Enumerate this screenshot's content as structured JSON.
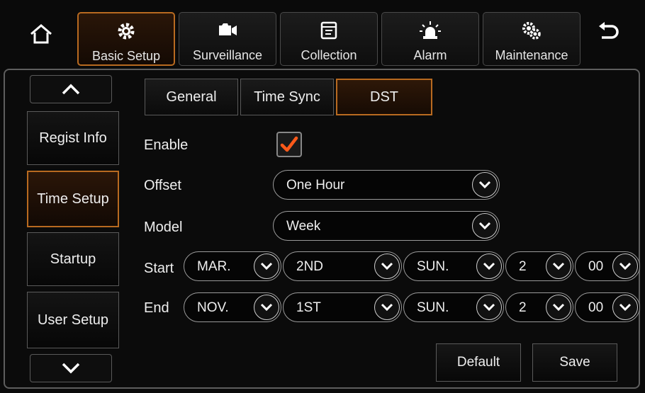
{
  "top_tabs": [
    {
      "label": "Basic Setup",
      "icon": "gear-icon",
      "active": true
    },
    {
      "label": "Surveillance",
      "icon": "camera-icon",
      "active": false
    },
    {
      "label": "Collection",
      "icon": "document-icon",
      "active": false
    },
    {
      "label": "Alarm",
      "icon": "siren-icon",
      "active": false
    },
    {
      "label": "Maintenance",
      "icon": "maintenance-gears-icon",
      "active": false
    }
  ],
  "sidebar": {
    "items": [
      {
        "label": "Regist Info"
      },
      {
        "label": "Time Setup"
      },
      {
        "label": "Startup"
      },
      {
        "label": "User Setup"
      }
    ],
    "active_index": 1
  },
  "sub_tabs": [
    {
      "label": "General"
    },
    {
      "label": "Time Sync"
    },
    {
      "label": "DST"
    }
  ],
  "form": {
    "enable_label": "Enable",
    "enable_checked": true,
    "offset_label": "Offset",
    "offset_value": "One Hour",
    "model_label": "Model",
    "model_value": "Week",
    "start_label": "Start",
    "start": {
      "month": "MAR.",
      "week": "2ND",
      "day": "SUN.",
      "hour": "2",
      "minute": "00"
    },
    "end_label": "End",
    "end": {
      "month": "NOV.",
      "week": "1ST",
      "day": "SUN.",
      "hour": "2",
      "minute": "00"
    }
  },
  "buttons": {
    "default_label": "Default",
    "save_label": "Save"
  },
  "colors": {
    "accent": "#b86a20",
    "check": "#ff5a1a"
  }
}
